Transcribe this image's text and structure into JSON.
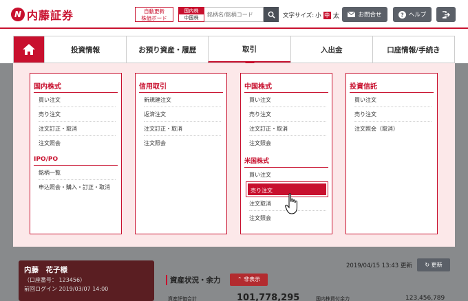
{
  "header": {
    "logo_text": "内藤証券",
    "logo_mark": "N",
    "auto_board_line1": "自動更新",
    "auto_board_line2": "株価ボード",
    "market_line1": "国内株",
    "market_line2": "中国株",
    "search_placeholder": "銘柄名/銘柄コード",
    "font_size_label": "文字サイズ:",
    "font_small": "小",
    "font_mid": "中",
    "font_large": "太",
    "contact_label": "お問合せ",
    "help_label": "ヘルプ"
  },
  "nav": {
    "tabs": [
      {
        "label": "投資情報"
      },
      {
        "label": "お預り資産・履歴"
      },
      {
        "label": "取引"
      },
      {
        "label": "入出金"
      },
      {
        "label": "口座情報/手続き"
      }
    ],
    "active_tab": "取引"
  },
  "menu": {
    "domestic": {
      "title": "国内株式",
      "items": [
        "買い注文",
        "売り注文",
        "注文訂正・取消",
        "注文照会"
      ],
      "sub_title": "IPO/PO",
      "sub_items": [
        "銘柄一覧",
        "申込照会・購入・訂正・取消"
      ]
    },
    "margin": {
      "title": "信用取引",
      "items": [
        "新規建注文",
        "返済注文",
        "注文訂正・取消",
        "注文照会"
      ]
    },
    "china": {
      "title": "中国株式",
      "items": [
        "買い注文",
        "売り注文",
        "注文訂正・取消",
        "注文照会"
      ],
      "sub_title": "米国株式",
      "sub_items": [
        "買い注文",
        "売り注文",
        "注文取消",
        "注文照会"
      ]
    },
    "fund": {
      "title": "投資信託",
      "items": [
        "買い注文",
        "売り注文",
        "注文照会（取消）"
      ]
    }
  },
  "account": {
    "name": "内藤　花子様",
    "number": "（口座番号： 123456）",
    "last_login": "前回ログイン  2019/03/07 14:00"
  },
  "summary": {
    "section_title": "資産状況・余力",
    "hide_label": "非表示",
    "updated_at": "2019/04/15 13:43 更新",
    "refresh_label": "更新",
    "label1": "資産評価合計",
    "value1": "101,778,295",
    "label2": "国内株買付余力",
    "value2": "123,456,789"
  },
  "colors": {
    "brand": "#c8102e"
  }
}
